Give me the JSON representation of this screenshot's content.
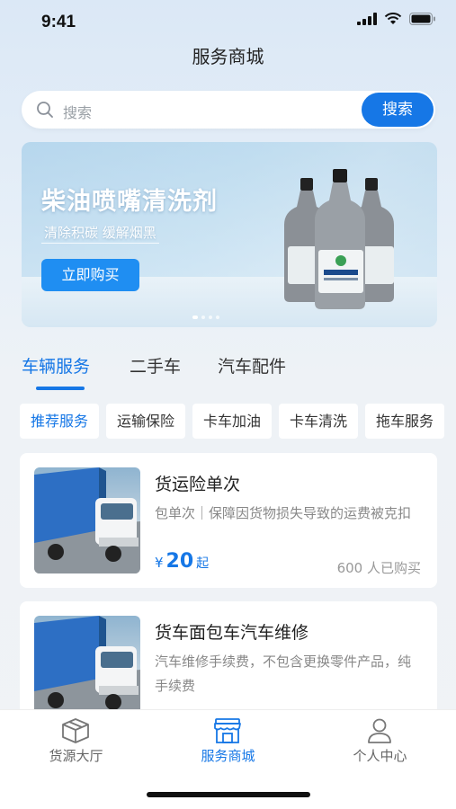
{
  "status_bar": {
    "time": "9:41"
  },
  "page_title": "服务商城",
  "search": {
    "placeholder": "搜索",
    "button_label": "搜索"
  },
  "banner": {
    "title": "柴油喷嘴清洗剂",
    "subtitle": "清除积碳  缓解烟黑",
    "button_label": "立即购买",
    "dots_count": 4,
    "active_dot": 0
  },
  "category_tabs": [
    {
      "label": "车辆服务",
      "active": true
    },
    {
      "label": "二手车",
      "active": false
    },
    {
      "label": "汽车配件",
      "active": false
    }
  ],
  "service_chips": [
    {
      "label": "推荐服务",
      "active": true
    },
    {
      "label": "运输保险",
      "active": false
    },
    {
      "label": "卡车加油",
      "active": false
    },
    {
      "label": "卡车清洗",
      "active": false
    },
    {
      "label": "拖车服务",
      "active": false
    }
  ],
  "products": [
    {
      "title": "货运险单次",
      "description": "包单次｜保障因货物损失导致的运费被克扣",
      "price_symbol": "¥",
      "price": "20",
      "price_suffix": "起",
      "sales": "600 人已购买"
    },
    {
      "title": "货车面包车汽车维修",
      "description": "汽车维修手续费，不包含更换零件产品，纯手续费",
      "price_symbol": "",
      "price": "",
      "price_suffix": "",
      "sales": ""
    }
  ],
  "bottom_tabs": [
    {
      "label": "货源大厅",
      "icon": "box-icon",
      "active": false
    },
    {
      "label": "服务商城",
      "icon": "shop-icon",
      "active": true
    },
    {
      "label": "个人中心",
      "icon": "user-icon",
      "active": false
    }
  ],
  "colors": {
    "accent": "#1677e6",
    "background": "#eef2f6"
  }
}
